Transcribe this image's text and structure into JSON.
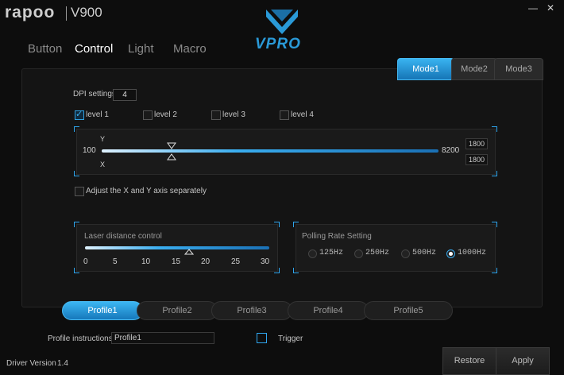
{
  "brand": {
    "name": "rapoo",
    "model": "V900"
  },
  "window": {
    "minimize_label": "—",
    "close_label": "✕"
  },
  "nav": {
    "tabs": [
      {
        "label": "Button",
        "active": false
      },
      {
        "label": "Control",
        "active": true
      },
      {
        "label": "Light",
        "active": false
      },
      {
        "label": "Macro",
        "active": false
      }
    ]
  },
  "logo": {
    "text": "VPRO"
  },
  "modes": [
    {
      "label": "Mode1",
      "active": true
    },
    {
      "label": "Mode2",
      "active": false
    },
    {
      "label": "Mode3",
      "active": false
    }
  ],
  "dpi": {
    "settings_label": "DPI settings",
    "count": "4",
    "levels": [
      {
        "label": "level 1",
        "checked": true
      },
      {
        "label": "level 2",
        "checked": false
      },
      {
        "label": "level 3",
        "checked": false
      },
      {
        "label": "level 4",
        "checked": false
      }
    ],
    "y_label": "Y",
    "x_label": "X",
    "min": "100",
    "max": "8200",
    "y_value": "1800",
    "x_value": "1800",
    "separate_label": "Adjust the X and Y axis separately",
    "separate_checked": false
  },
  "laser": {
    "title": "Laser distance control",
    "ticks": [
      "0",
      "5",
      "10",
      "15",
      "20",
      "25",
      "30"
    ],
    "value": 17
  },
  "polling": {
    "title": "Polling Rate Setting",
    "options": [
      {
        "label": "125Hz",
        "selected": false
      },
      {
        "label": "250Hz",
        "selected": false
      },
      {
        "label": "500Hz",
        "selected": false
      },
      {
        "label": "1000Hz",
        "selected": true
      }
    ]
  },
  "profiles": [
    {
      "label": "Profile1",
      "active": true
    },
    {
      "label": "Profile2",
      "active": false
    },
    {
      "label": "Profile3",
      "active": false
    },
    {
      "label": "Profile4",
      "active": false
    },
    {
      "label": "Profile5",
      "active": false
    }
  ],
  "footer": {
    "profile_instructions_label": "Profile instructions",
    "profile_instructions_value": "Profile1",
    "trigger_label": "Trigger",
    "driver_version_label": "Driver Version",
    "driver_version": "1.4",
    "restore_label": "Restore",
    "apply_label": "Apply"
  },
  "colors": {
    "accent": "#2fa6ee",
    "background": "#0d0d0d"
  }
}
